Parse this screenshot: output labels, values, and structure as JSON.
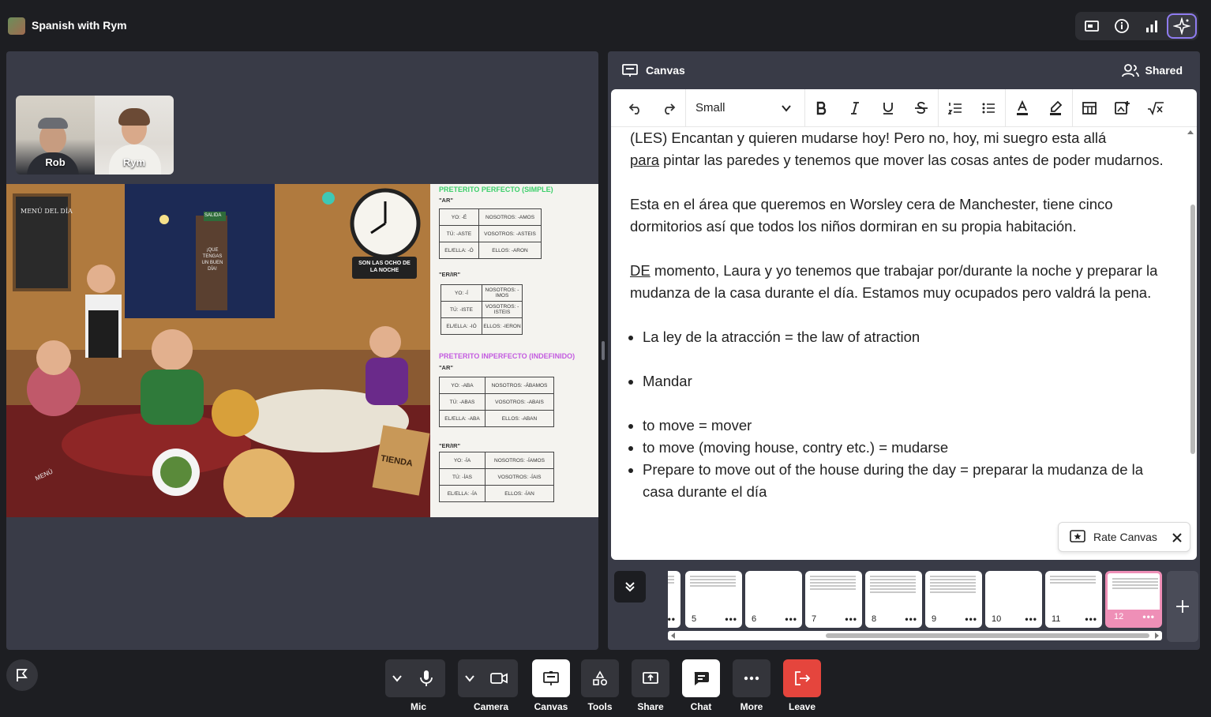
{
  "app": {
    "title": "Spanish with Rym"
  },
  "participants": [
    {
      "name": "Rob"
    },
    {
      "name": "Rym"
    }
  ],
  "slide": {
    "menu_text": "MENÚ DEL DÍA",
    "clock_caption": "SON LAS OCHO DE LA NOCHE",
    "sign_salida": "SALIDA",
    "sign_que": "¡QUE TENGAS UN BUEN DÍA!",
    "bag_text": "TIENDA",
    "menu_card": "MENÚ",
    "section1": {
      "title": "PRETERITO PERFECTO (SIMPLE)",
      "groups": [
        {
          "label": "\"AR\"",
          "rows": [
            [
              "YO: -É",
              "NOSOTROS: -AMOS"
            ],
            [
              "TÚ: -ASTE",
              "VOSOTROS: -ASTEIS"
            ],
            [
              "EL/ELLA: -Ó",
              "ELLOS: -ARON"
            ]
          ]
        },
        {
          "label": "\"ER/IR\"",
          "rows": [
            [
              "YO: -Í",
              "NOSOTROS: -IMOS"
            ],
            [
              "TÚ: -ISTE",
              "VOSOTROS: -ISTEIS"
            ],
            [
              "EL/ELLA: -IÓ",
              "ELLOS: -IERON"
            ]
          ]
        }
      ]
    },
    "section2": {
      "title": "PRETERITO INPERFECTO (INDEFINIDO)",
      "groups": [
        {
          "label": "\"AR\"",
          "rows": [
            [
              "YO: -ABA",
              "NOSOTROS: -ÁBAMOS"
            ],
            [
              "TÚ: -ABAS",
              "VOSOTROS: -ABAIS"
            ],
            [
              "EL/ELLA: -ABA",
              "ELLOS: -ABAN"
            ]
          ]
        },
        {
          "label": "\"ER/IR\"",
          "rows": [
            [
              "YO: -ÍA",
              "NOSOTROS: -ÍAMOS"
            ],
            [
              "TÚ: -ÍAS",
              "VOSOTROS: -ÍAIS"
            ],
            [
              "EL/ELLA: -ÍA",
              "ELLOS: -ÍAN"
            ]
          ]
        }
      ]
    }
  },
  "canvas": {
    "title": "Canvas",
    "shared_label": "Shared",
    "font_size": "Small",
    "paragraphs": [
      "(LES) Encantan y quieren mudarse hoy! Pero no, hoy, mi suegro esta allá",
      "para",
      "pintar las paredes y tenemos que mover las cosas antes de poder mudarnos.",
      "Esta en el área que queremos en Worsley cera de Manchester, tiene cinco dormitorios así que todos los niños dormiran en su propia habitación.",
      "DE",
      "momento, Laura y yo tenemos que trabajar por/durante la noche y preparar la mudanza de la casa durante el día. Estamos muy ocupados pero valdrá la pena."
    ],
    "bullets_1": [
      "La ley de la atracción = the law of atraction"
    ],
    "bullets_2": [
      "Mandar"
    ],
    "bullets_3": [
      "to move = mover",
      "to move (moving house, contry etc.) = mudarse",
      "Prepare to move out of the house during the day = preparar la mudanza de la casa durante el día"
    ],
    "rate_label": "Rate Canvas",
    "pages": [
      {
        "num": "5"
      },
      {
        "num": "6"
      },
      {
        "num": "7"
      },
      {
        "num": "8"
      },
      {
        "num": "9"
      },
      {
        "num": "10"
      },
      {
        "num": "11"
      },
      {
        "num": "12"
      }
    ],
    "more_glyph": "•••"
  },
  "controls": {
    "mic": "Mic",
    "camera": "Camera",
    "canvas": "Canvas",
    "tools": "Tools",
    "share": "Share",
    "chat": "Chat",
    "more": "More",
    "leave": "Leave"
  },
  "colors": {
    "accent_purple": "#8f7cf0",
    "leave_red": "#e5453d",
    "active_page_pink": "#ef8fb7",
    "section1_green": "#3ccf6a",
    "section2_purple": "#c35be0"
  }
}
